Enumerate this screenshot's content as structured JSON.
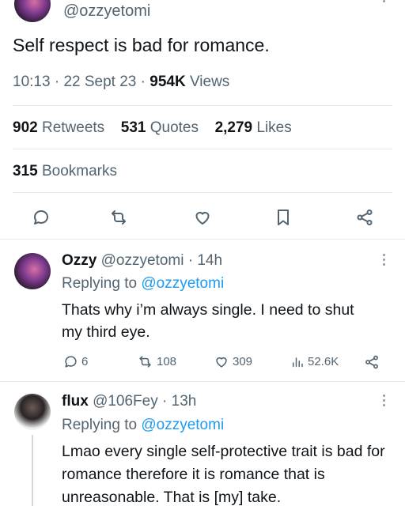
{
  "main_tweet": {
    "handle": "@ozzyetomi",
    "text": "Self respect is bad for romance.",
    "time": "10:13",
    "date": "22 Sept 23",
    "views_count": "954K",
    "views_label": "Views",
    "retweets_count": "902",
    "retweets_label": "Retweets",
    "quotes_count": "531",
    "quotes_label": "Quotes",
    "likes_count": "2,279",
    "likes_label": "Likes",
    "bookmarks_count": "315",
    "bookmarks_label": "Bookmarks",
    "actions": [
      "reply-icon",
      "retweet-icon",
      "like-icon",
      "bookmark-icon",
      "share-icon"
    ]
  },
  "replies": [
    {
      "name": "Ozzy",
      "handle": "@ozzyetomi",
      "age": "14h",
      "replying_prefix": "Replying to",
      "replying_to": "@ozzyetomi",
      "text": "Thats why i’m always single. I need to shut my third eye.",
      "reply_count": "6",
      "retweet_count": "108",
      "like_count": "309",
      "view_count": "52.6K"
    },
    {
      "name": "flux",
      "handle": "@106Fey",
      "age": "13h",
      "replying_prefix": "Replying to",
      "replying_to": "@ozzyetomi",
      "text": "Lmao every single self-protective trait is bad for romance therefore it is romance that is unreasonable. That is [my] take."
    }
  ],
  "colors": {
    "link": "#1d9bf0",
    "muted": "#536471",
    "text": "#0f1419"
  }
}
